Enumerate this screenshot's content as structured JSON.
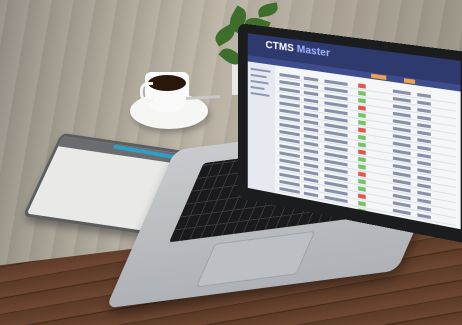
{
  "photo": {
    "screen_app_title_part1": "CTMS",
    "screen_app_title_part2": "Master",
    "colors": {
      "app_header": "#2e3a6e",
      "accent_orange": "#f0a34a",
      "status_green": "#74c466",
      "status_red": "#e3564a",
      "pen_blue": "#2f9fc5"
    },
    "objects": [
      "laptop",
      "graphics-tablet",
      "stylus-pen",
      "coffee-cup",
      "saucer",
      "spoon",
      "potted-plant",
      "wooden-table",
      "wooden-deck"
    ]
  }
}
